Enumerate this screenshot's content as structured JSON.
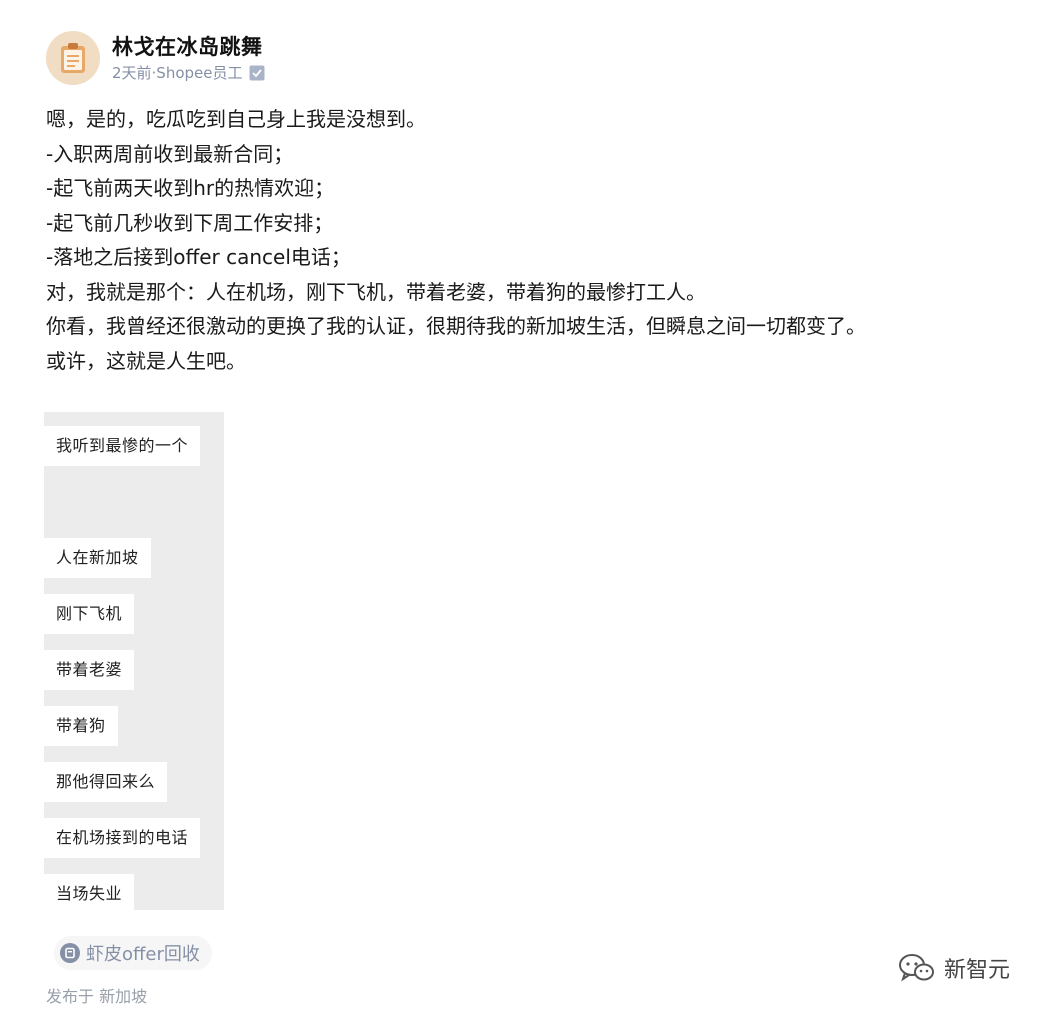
{
  "header": {
    "author_name": "林戈在冰岛跳舞",
    "meta": "2天前·Shopee员工",
    "avatar_icon": "clipboard-avatar-icon",
    "verified_icon": "verified-badge-icon"
  },
  "content": {
    "lines": [
      "嗯，是的，吃瓜吃到自己身上我是没想到。",
      "-入职两周前收到最新合同；",
      "-起飞前两天收到hr的热情欢迎；",
      "-起飞前几秒收到下周工作安排；",
      "-落地之后接到offer cancel电话；",
      "对，我就是那个：人在机场，刚下飞机，带着老婆，带着狗的最惨打工人。",
      "你看，我曾经还很激动的更换了我的认证，很期待我的新加坡生活，但瞬息之间一切都变了。",
      "或许，这就是人生吧。"
    ]
  },
  "chat_card": {
    "bubbles": [
      "我听到最惨的一个",
      "人在新加坡",
      "刚下飞机",
      "带着老婆",
      "带着狗",
      "那他得回来么",
      "在机场接到的电话",
      "当场失业"
    ]
  },
  "topic": {
    "label": "虾皮offer回收",
    "icon": "topic-circle-icon"
  },
  "location": "发布于 新加坡",
  "watermark": {
    "label": "新智元",
    "icon": "wechat-icon"
  },
  "colors": {
    "meta_gray": "#8590a6",
    "avatar_bg": "#f1dcc4",
    "card_bg": "#ececec"
  }
}
